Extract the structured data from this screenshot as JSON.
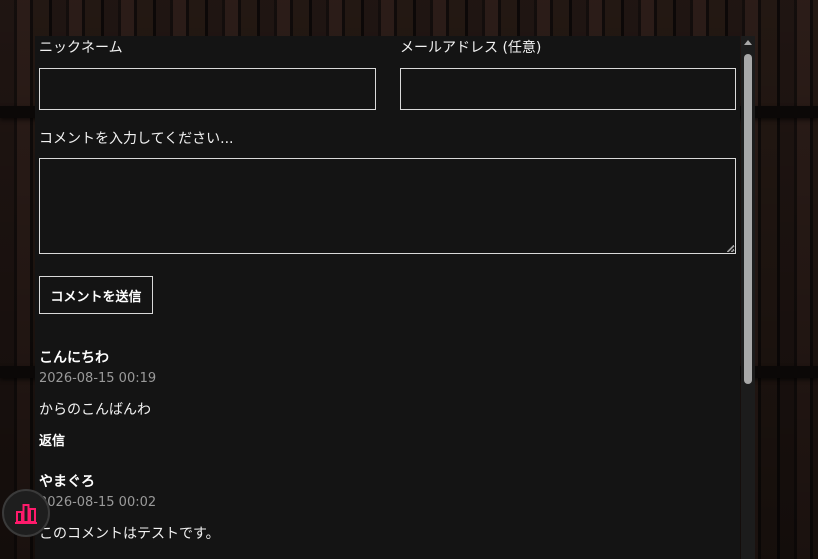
{
  "form": {
    "nickname_label": "ニックネーム",
    "nickname_value": "",
    "email_label": "メールアドレス (任意)",
    "email_value": "",
    "comment_label": "コメントを入力してください...",
    "comment_value": "",
    "submit_label": "コメントを送信"
  },
  "comments": [
    {
      "name": "こんにちわ",
      "date": "2026-08-15 00:19",
      "body": "からのこんばんわ",
      "reply_label": "返信"
    },
    {
      "name": "やまぐろ",
      "date": "2026-08-15 00:02",
      "body": "このコメントはテストです。"
    }
  ],
  "floating": {
    "icon": "bar-chart-icon",
    "accent": "#ff1a6b"
  },
  "colors": {
    "panel": "#141414",
    "text": "#f2f2f2",
    "muted": "#9a9a9a",
    "border": "#d9d9d9"
  }
}
